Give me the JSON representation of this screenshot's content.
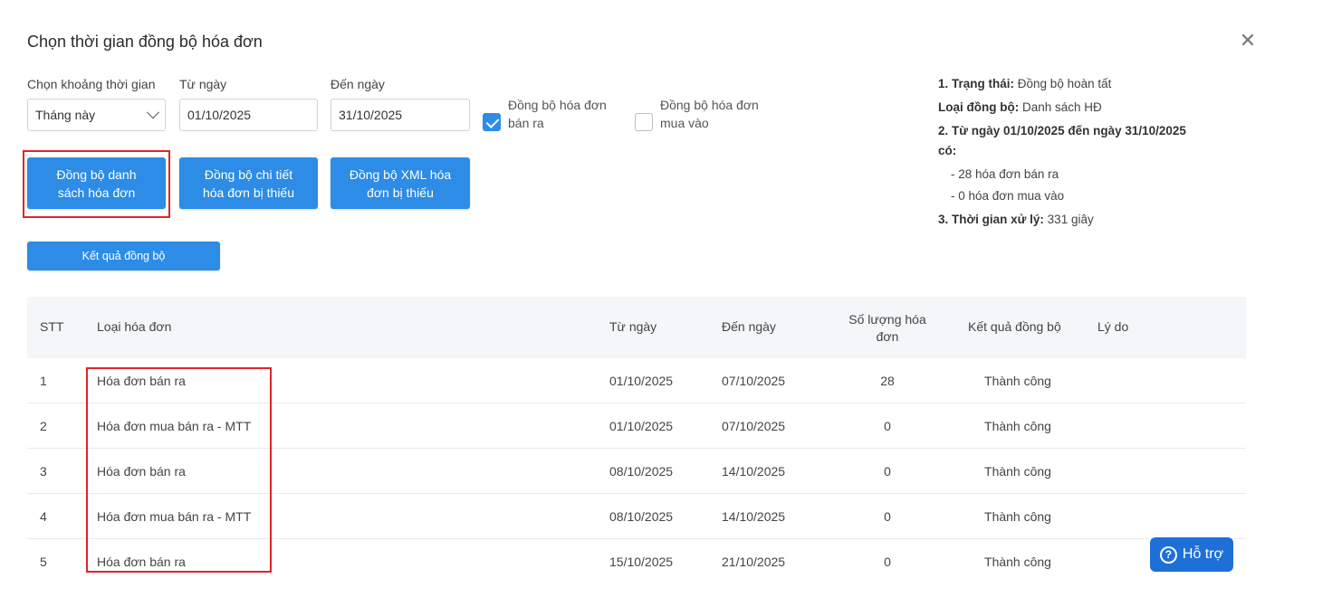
{
  "dialog": {
    "title": "Chọn thời gian đồng bộ hóa đơn",
    "close_glyph": "✕"
  },
  "filters": {
    "period_label": "Chọn khoảng thời gian",
    "period_value": "Tháng này",
    "from_label": "Từ ngày",
    "from_value": "01/10/2025",
    "to_label": "Đến ngày",
    "to_value": "31/10/2025",
    "sync_sales_label_1": "Đồng bộ hóa đơn",
    "sync_sales_label_2": "bán ra",
    "sync_sales_checked": true,
    "sync_purchase_label_1": "Đồng bộ hóa đơn",
    "sync_purchase_label_2": "mua vào",
    "sync_purchase_checked": false
  },
  "actions": {
    "sync_list_1": "Đồng bộ danh",
    "sync_list_2": "sách hóa đơn",
    "sync_detail_1": "Đồng bộ chi tiết",
    "sync_detail_2": "hóa đơn bị thiếu",
    "sync_xml_1": "Đồng bộ XML hóa",
    "sync_xml_2": "đơn bị thiếu",
    "result": "Kết quả đồng bộ"
  },
  "status": {
    "status_key": "1. Trạng thái:",
    "status_val": "Đồng bộ hoàn tất",
    "type_key": "Loại đồng bộ:",
    "type_val": "Danh sách HĐ",
    "range_key_1": "2. Từ ngày 01/10/2025 đến ngày 31/10/2025",
    "range_key_2": "có:",
    "sales_count": "- 28 hóa đơn bán ra",
    "purchase_count": "- 0 hóa đơn mua vào",
    "time_key": "3. Thời gian xử lý:",
    "time_val": "331 giây"
  },
  "table": {
    "headers": {
      "stt": "STT",
      "type": "Loại hóa đơn",
      "from": "Từ ngày",
      "to": "Đến ngày",
      "qty_1": "Số lượng hóa",
      "qty_2": "đơn",
      "result": "Kết quả đồng bộ",
      "reason": "Lý do"
    },
    "rows": [
      {
        "stt": "1",
        "type": "Hóa đơn bán ra",
        "from": "01/10/2025",
        "to": "07/10/2025",
        "qty": "28",
        "result": "Thành công",
        "reason": ""
      },
      {
        "stt": "2",
        "type": "Hóa đơn mua bán ra - MTT",
        "from": "01/10/2025",
        "to": "07/10/2025",
        "qty": "0",
        "result": "Thành công",
        "reason": ""
      },
      {
        "stt": "3",
        "type": "Hóa đơn bán ra",
        "from": "08/10/2025",
        "to": "14/10/2025",
        "qty": "0",
        "result": "Thành công",
        "reason": ""
      },
      {
        "stt": "4",
        "type": "Hóa đơn mua bán ra - MTT",
        "from": "08/10/2025",
        "to": "14/10/2025",
        "qty": "0",
        "result": "Thành công",
        "reason": ""
      },
      {
        "stt": "5",
        "type": "Hóa đơn bán ra",
        "from": "15/10/2025",
        "to": "21/10/2025",
        "qty": "0",
        "result": "Thành công",
        "reason": ""
      }
    ]
  },
  "help": {
    "icon_glyph": "?",
    "label": "Hỗ trợ"
  },
  "colors": {
    "primary": "#2c8ce6",
    "highlight": "#e0242b",
    "help": "#1f6fd8"
  }
}
